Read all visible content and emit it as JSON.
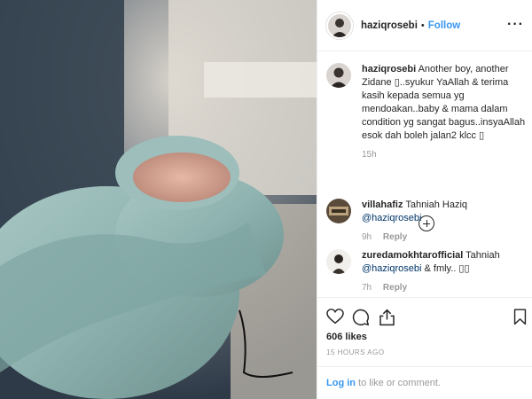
{
  "post": {
    "username": "haziqrosebi",
    "separator": "•",
    "follow_label": "Follow",
    "more_label": "···"
  },
  "caption": {
    "username": "haziqrosebi",
    "text": "Another boy, another Zidane ▯..syukur YaAllah & terima kasih kepada semua yg mendoakan..baby & mama dalam condition yg sangat bagus..insyaAllah esok dah boleh jalan2 klcc ▯",
    "time": "15h"
  },
  "comments": [
    {
      "username": "villahafiz",
      "text": "Tahniah Haziq ",
      "mention": "@haziqrosebi",
      "text_after": "",
      "time": "9h",
      "reply_label": "Reply"
    },
    {
      "username": "zuredamokhtarofficial",
      "text": "Tahniah ",
      "mention": "@haziqrosebi",
      "text_after": " & fmly.. ▯▯",
      "time": "7h",
      "reply_label": "Reply"
    }
  ],
  "likes": "606 likes",
  "timestamp": "15 HOURS AGO",
  "login": {
    "link_label": "Log in",
    "suffix": " to like or comment."
  },
  "icons": [
    "heart-icon",
    "comment-icon",
    "share-icon",
    "bookmark-icon",
    "plus-circle-icon",
    "more-icon"
  ],
  "colors": {
    "link": "#3897f0",
    "muted": "#999999",
    "text": "#262626",
    "blanket": "#8fb3b0"
  }
}
